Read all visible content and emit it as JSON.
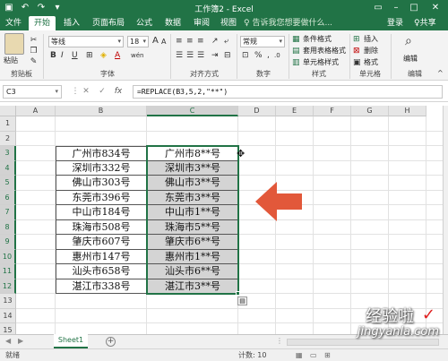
{
  "window": {
    "title": "工作簿2 - Excel"
  },
  "tabs": [
    "文件",
    "开始",
    "插入",
    "页面布局",
    "公式",
    "数据",
    "审阅",
    "视图"
  ],
  "active_tab": 1,
  "tell_me": "♀ 告诉我您想要做什么...",
  "account": {
    "login": "登录",
    "share": "♀共享"
  },
  "ribbon": {
    "clipboard": {
      "paste": "粘贴",
      "group": "剪贴板"
    },
    "font": {
      "name": "等线",
      "size": "18",
      "group": "字体",
      "bold": "B",
      "italic": "I",
      "underline": "U",
      "grow": "A",
      "shrink": "A",
      "font_color": "A",
      "phonetic": "wén"
    },
    "alignment": {
      "group": "对齐方式"
    },
    "number": {
      "format": "常规",
      "group": "数字",
      "percent": "%",
      "comma": ",",
      "currency": "⊡"
    },
    "styles": {
      "conditional": "条件格式",
      "table": "套用表格格式",
      "cell": "单元格样式",
      "group": "样式"
    },
    "cells": {
      "insert": "插入",
      "delete": "删除",
      "format": "格式",
      "group": "单元格"
    },
    "editing": {
      "label": "编辑",
      "group": "编辑"
    }
  },
  "formula_bar": {
    "name_box": "C3",
    "cancel": "✕",
    "enter": "✓",
    "fx": "fx",
    "formula": "=REPLACE(B3,5,2,\"**\")"
  },
  "columns": [
    "A",
    "B",
    "C",
    "D",
    "E",
    "F",
    "G",
    "H"
  ],
  "selected_column": "C",
  "rows": [
    "1",
    "2",
    "3",
    "4",
    "5",
    "6",
    "7",
    "8",
    "9",
    "10",
    "11",
    "12",
    "13",
    "14",
    "15",
    "16",
    "17"
  ],
  "table": {
    "original": [
      "广州市834号",
      "深圳市332号",
      "佛山市303号",
      "东莞市396号",
      "中山市184号",
      "珠海市508号",
      "肇庆市607号",
      "惠州市147号",
      "汕头市658号",
      "湛江市338号"
    ],
    "replaced": [
      "广州市8**号",
      "深圳市3**号",
      "佛山市3**号",
      "东莞市3**号",
      "中山市1**号",
      "珠海市5**号",
      "肇庆市6**号",
      "惠州市1**号",
      "汕头市6**号",
      "湛江市3**号"
    ]
  },
  "sheets": [
    "Sheet1"
  ],
  "status": {
    "ready": "就绪",
    "count": "计数: 10"
  },
  "watermark": {
    "line1": "经验啦",
    "check": "✓",
    "line2": "jingyanla.com"
  },
  "colors": {
    "accent": "#217346",
    "arrow": "#e2583a"
  }
}
